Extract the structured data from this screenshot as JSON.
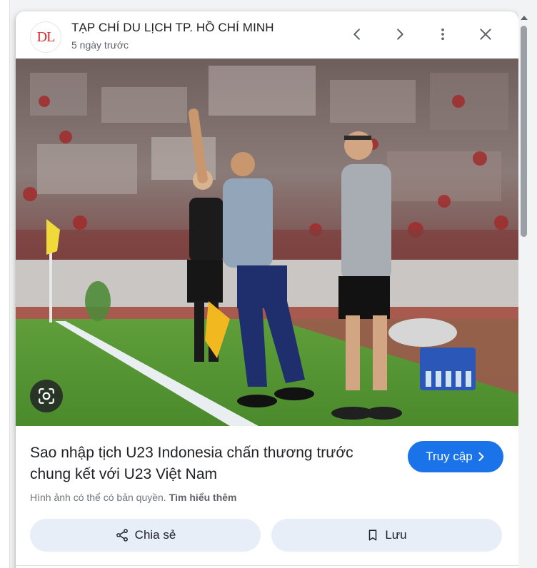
{
  "header": {
    "logo_text": "DL",
    "source_name": "TẠP CHÍ DU LỊCH TP. HỒ CHÍ MINH",
    "date": "5 ngày trước",
    "icons": [
      "chevron-left-icon",
      "chevron-right-icon",
      "more-vert-icon",
      "close-icon"
    ]
  },
  "image": {
    "lens_icon": "google-lens-icon"
  },
  "article": {
    "title": "Sao nhập tịch U23 Indonesia chấn thương trước chung kết với U23 Việt Nam",
    "visit_label": "Truy cập",
    "copyright_text": "Hình ảnh có thể có bản quyền.",
    "learn_more": "Tìm hiểu thêm"
  },
  "actions": {
    "share_label": "Chia sẻ",
    "save_label": "Lưu"
  },
  "colors": {
    "accent": "#1a73e8",
    "action_bg": "#e8eef8",
    "logo_red": "#d32f2f"
  }
}
